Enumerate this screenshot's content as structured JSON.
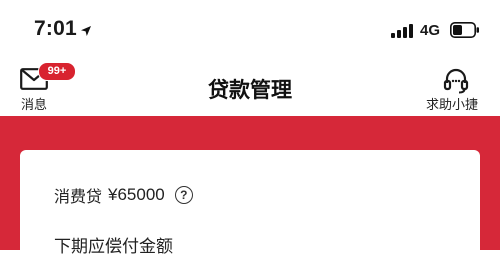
{
  "status_bar": {
    "time": "7:01",
    "network": "4G",
    "icons": [
      "location-arrow-icon",
      "signal-icon",
      "battery-icon"
    ]
  },
  "nav": {
    "messages_label": "消息",
    "messages_badge": "99+",
    "title": "贷款管理",
    "help_label": "求助小捷",
    "icons": [
      "mail-icon",
      "headset-icon"
    ]
  },
  "loan": {
    "type_label": "消费贷",
    "amount": "¥65000",
    "info_icon": "question-circle-icon",
    "due_label": "下期应偿付金额"
  },
  "colors": {
    "accent_red": "#d62839",
    "badge_red": "#d8232f",
    "card_background": "#ffffff"
  }
}
